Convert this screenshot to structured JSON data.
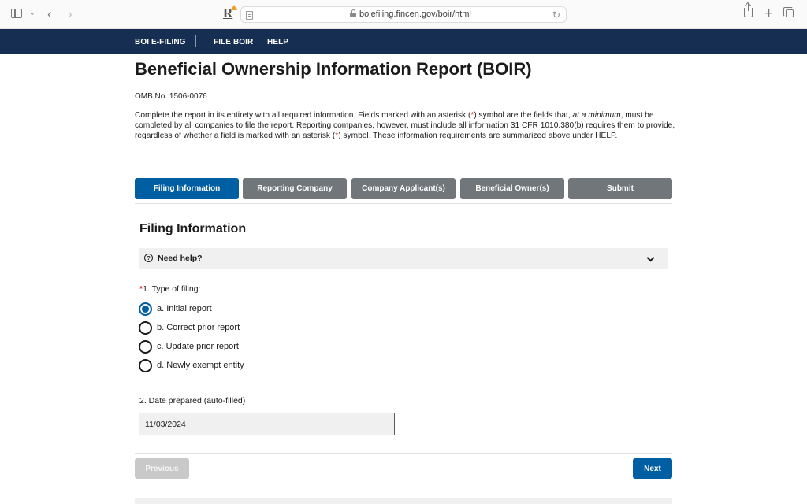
{
  "browser": {
    "url": "boiefiling.fincen.gov/boir/html",
    "icons": {
      "sidebar": "sidebar-icon",
      "tab_menu": "chevron-down-icon",
      "back": "back-arrow-icon",
      "forward": "forward-arrow-icon",
      "extension": "extension-r-icon",
      "reader": "reader-mode-icon",
      "lock": "lock-icon",
      "reload": "reload-icon",
      "share": "share-icon",
      "new_tab": "plus-icon",
      "tab_overview": "tabs-icon"
    },
    "glyphs": {
      "tab_menu": "⌄",
      "back": "‹",
      "forward": "›",
      "extension": "R",
      "reload": "↻",
      "new_tab": "+"
    }
  },
  "site_nav": {
    "items": [
      {
        "label": "BOI E-FILING"
      },
      {
        "label": "FILE BOIR"
      },
      {
        "label": "HELP"
      }
    ]
  },
  "page": {
    "title": "Beneficial Ownership Information Report (BOIR)",
    "omb": "OMB No. 1506-0076",
    "intro": {
      "part1": "Complete the report in its entirety with all required information. Fields marked with an asterisk (",
      "asterisk": "*",
      "part2": ") symbol are the fields that, ",
      "emphasis": "at a minimum",
      "part3": ", must be completed by all companies to file the report. Reporting companies, however, must include all information 31 CFR 1010.380(b) requires them to provide, regardless of whether a field is marked with an asterisk (",
      "part4": ") symbol. These information requirements are summarized above under HELP."
    }
  },
  "steps": [
    {
      "label": "Filing Information",
      "active": true
    },
    {
      "label": "Reporting Company",
      "active": false
    },
    {
      "label": "Company Applicant(s)",
      "active": false
    },
    {
      "label": "Beneficial Owner(s)",
      "active": false
    },
    {
      "label": "Submit",
      "active": false
    }
  ],
  "section": {
    "title": "Filing Information",
    "help": {
      "label": "Need help?",
      "icon_glyph": "?"
    }
  },
  "form": {
    "type_of_filing": {
      "required_mark": "*",
      "label": "1. Type of filing:",
      "options": [
        {
          "label": "a. Initial report",
          "checked": true
        },
        {
          "label": "b. Correct prior report",
          "checked": false
        },
        {
          "label": "c. Update prior report",
          "checked": false
        },
        {
          "label": "d. Newly exempt entity",
          "checked": false
        }
      ]
    },
    "date_prepared": {
      "label": "2. Date prepared (auto-filled)",
      "value": "11/03/2024"
    }
  },
  "footer": {
    "previous_label": "Previous",
    "next_label": "Next"
  },
  "colors": {
    "nav_bg": "#162e51",
    "primary": "#005ea2",
    "step_inactive": "#71767a",
    "required": "#d83933",
    "disabled": "#c9c9c9"
  }
}
